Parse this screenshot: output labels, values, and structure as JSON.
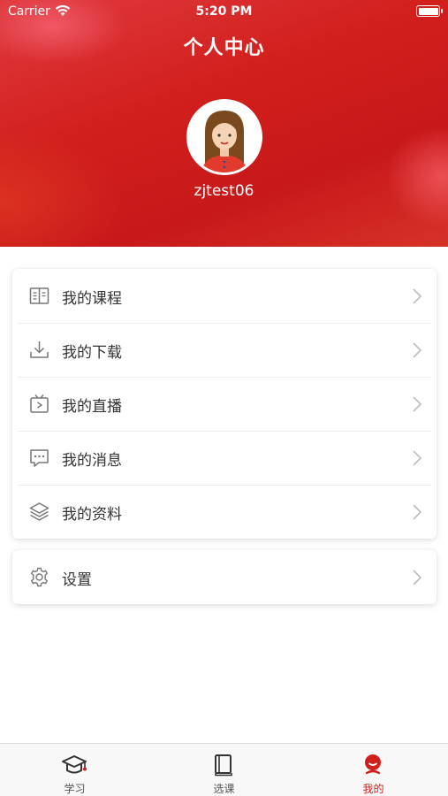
{
  "status_bar": {
    "carrier": "Carrier",
    "time": "5:20 PM"
  },
  "header": {
    "title": "个人中心",
    "username": "zjtest06"
  },
  "menu": {
    "items": [
      {
        "label": "我的课程",
        "icon": "book-icon"
      },
      {
        "label": "我的下载",
        "icon": "download-icon"
      },
      {
        "label": "我的直播",
        "icon": "live-tv-icon"
      },
      {
        "label": "我的消息",
        "icon": "message-icon"
      },
      {
        "label": "我的资料",
        "icon": "layers-icon"
      }
    ],
    "settings": {
      "label": "设置",
      "icon": "gear-icon"
    }
  },
  "tabbar": {
    "tabs": [
      {
        "label": "学习",
        "icon": "graduation-cap-icon",
        "active": false
      },
      {
        "label": "选课",
        "icon": "book-select-icon",
        "active": false
      },
      {
        "label": "我的",
        "icon": "profile-icon",
        "active": true
      }
    ]
  },
  "colors": {
    "accent": "#d0201e",
    "header_red": "#d21f1c",
    "text": "#333333",
    "icon_gray": "#777777"
  }
}
